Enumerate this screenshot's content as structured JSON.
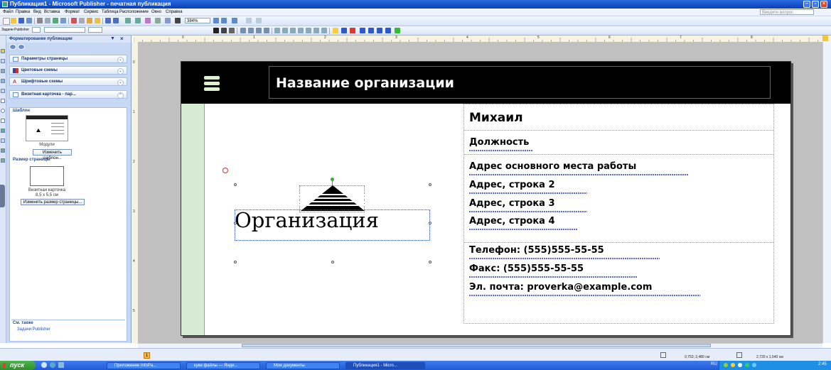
{
  "window": {
    "title": "Публикация1 - Microsoft Publisher - печатная публикация",
    "help_placeholder": "Введите вопрос"
  },
  "menu": [
    "Файл",
    "Правка",
    "Вид",
    "Вставка",
    "Формат",
    "Сервис",
    "Таблица",
    "Расположение",
    "Окно",
    "Справка"
  ],
  "toolbar": {
    "zoom": "384%",
    "task_label": "Задачи Publisher"
  },
  "task_pane": {
    "title": "Форматирование публикации",
    "sections": [
      {
        "label": "Параметры страницы"
      },
      {
        "label": "Цветовые схемы"
      },
      {
        "label": "Шрифтовые схемы"
      },
      {
        "label": "Визитная карточка - пар..."
      }
    ],
    "template_heading": "Шаблон",
    "template_name": "Модули",
    "change_template": "Изменить шаблон...",
    "page_size_heading": "Размер страницы",
    "page_size_name": "Визитная карточка",
    "page_size_dims": "8,5 x 5,5 см",
    "change_page_size": "Изменить размер страницы...",
    "see_also_heading": "См. также",
    "see_also_link": "Задачи Publisher"
  },
  "ruler": {
    "h_numbers": [
      "0",
      "1",
      "2",
      "3",
      "4",
      "5",
      "6",
      "7",
      "8"
    ],
    "v_numbers": [
      "0",
      "1",
      "2",
      "3",
      "4",
      "5"
    ]
  },
  "card": {
    "org_title": "Название организации",
    "name": "Михаил",
    "position": "Должность",
    "address1": "Адрес основного места работы",
    "address2": "Адрес, строка 2",
    "address3": "Адрес, строка 3",
    "address4": "Адрес, строка 4",
    "phone": "Телефон: (555)555-55-55",
    "fax": "Факс: (555)555-55-55",
    "email": "Эл. почта: proverka@example.com",
    "logo_text": "Организация"
  },
  "status": {
    "page": "1",
    "position": "0,753; 2,480 см",
    "size": "2,720 x 1,540 см"
  },
  "taskbar": {
    "start": "пуск",
    "tasks": [
      "Приложение InfoPa...",
      "куки файлы — Янде...",
      "Мои документы",
      "Публикация1 - Micro..."
    ],
    "lang": "RU",
    "clock": "2:45"
  },
  "colors": {
    "title_bar": "#0a3fb8",
    "card_header": "#000000",
    "green_strip": "#d5ecd3",
    "taskbar": "#225ad6"
  }
}
